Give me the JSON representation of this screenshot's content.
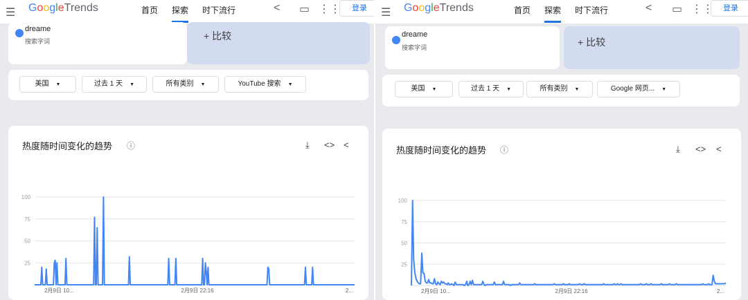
{
  "header": {
    "logo_google_letters": [
      "G",
      "o",
      "o",
      "g",
      "l",
      "e"
    ],
    "logo_trends": "Trends",
    "nav": [
      {
        "label": "首页"
      },
      {
        "label": "探索"
      },
      {
        "label": "时下流行"
      }
    ],
    "login_label": "登录",
    "icons": [
      "menu-icon",
      "share-icon",
      "feedback-icon",
      "apps-icon"
    ]
  },
  "accent_color": "#1a73e8",
  "series_color": "#4285f4",
  "left": {
    "term": "dreame",
    "term_sub": "搜索字词",
    "compare_label": "+ 比较",
    "filters": [
      "美国",
      "过去 1 天",
      "所有类别",
      "YouTube 搜索"
    ],
    "chart_title": "热度随时间变化的趋势",
    "chart_data": {
      "type": "line",
      "ylim": [
        0,
        100
      ],
      "yticks": [
        "100",
        "75",
        "50",
        "25"
      ],
      "xticks": [
        "2月9日 10...",
        "2月9日 22:16",
        "2..."
      ],
      "values": [
        0,
        0,
        0,
        0,
        0,
        0,
        0,
        0,
        20,
        0,
        0,
        0,
        0,
        18,
        0,
        0,
        0,
        0,
        0,
        0,
        0,
        0,
        25,
        28,
        0,
        25,
        0,
        0,
        0,
        0,
        0,
        0,
        0,
        0,
        0,
        30,
        0,
        0,
        0,
        0,
        0,
        0,
        0,
        0,
        0,
        0,
        0,
        0,
        0,
        0,
        0,
        0,
        0,
        0,
        0,
        0,
        0,
        0,
        0,
        0,
        0,
        0,
        0,
        0,
        0,
        0,
        0,
        77,
        0,
        0,
        65,
        0,
        0,
        0,
        0,
        0,
        0,
        100,
        0,
        0,
        0,
        0,
        0,
        0,
        0,
        0,
        0,
        0,
        0,
        0,
        0,
        0,
        0,
        0,
        0,
        0,
        0,
        0,
        0,
        0,
        0,
        0,
        0,
        0,
        0,
        0,
        32,
        0,
        0,
        0,
        0,
        0,
        0,
        0,
        0,
        0,
        0,
        0,
        0,
        0,
        0,
        0,
        0,
        0,
        0,
        0,
        0,
        0,
        0,
        0,
        0,
        0,
        0,
        0,
        0,
        0,
        0,
        0,
        0,
        0,
        0,
        0,
        0,
        0,
        0,
        0,
        0,
        0,
        0,
        0,
        30,
        0,
        0,
        0,
        0,
        0,
        0,
        0,
        30,
        0,
        0,
        0,
        0,
        0,
        0,
        0,
        0,
        0,
        0,
        0,
        0,
        0,
        0,
        0,
        0,
        0,
        0,
        0,
        0,
        0,
        0,
        0,
        0,
        0,
        0,
        0,
        0,
        0,
        30,
        0,
        0,
        25,
        15,
        0,
        20,
        0,
        0,
        0,
        0,
        0,
        0,
        0,
        0,
        0,
        0,
        0,
        0,
        0,
        0,
        0,
        0,
        0,
        0,
        0,
        0,
        0,
        0,
        0,
        0,
        0,
        0,
        0,
        0,
        0,
        0,
        0,
        0,
        0,
        0,
        0,
        0,
        0,
        0,
        0,
        0,
        0,
        0,
        0,
        0,
        0,
        0,
        0,
        0,
        0,
        0,
        0,
        0,
        0,
        0,
        0,
        0,
        0,
        0,
        0,
        0,
        0,
        0,
        0,
        0,
        0,
        0,
        20,
        18,
        0,
        0,
        0,
        0,
        0,
        0,
        0,
        0,
        0,
        0,
        0,
        0,
        0,
        0,
        0,
        0,
        0,
        0,
        0,
        0,
        0,
        0,
        0,
        0,
        0,
        0,
        0,
        0,
        0,
        0,
        0,
        0,
        0,
        0,
        0,
        0,
        0,
        0,
        0,
        0,
        20,
        0,
        0,
        0,
        0,
        0,
        0,
        0,
        20,
        0,
        0,
        0,
        0,
        0,
        0,
        0,
        0,
        0,
        0,
        0,
        0,
        0,
        0,
        0,
        0,
        0,
        0,
        0,
        0,
        0,
        0,
        0,
        0,
        0,
        0,
        0,
        0,
        0,
        0,
        0,
        0,
        0,
        0,
        0,
        0,
        0,
        0,
        0,
        0,
        0,
        0,
        0,
        0,
        0,
        0,
        0
      ]
    }
  },
  "right": {
    "term": "dreame",
    "term_sub": "搜索字词",
    "compare_label": "+ 比较",
    "filters": [
      "美国",
      "过去 1 天",
      "所有类别",
      "Google 网页..."
    ],
    "chart_title": "热度随时间变化的趋势",
    "chart_data": {
      "type": "line",
      "ylim": [
        0,
        100
      ],
      "yticks": [
        "100",
        "75",
        "50",
        "25"
      ],
      "xticks": [
        "2月9日 10...",
        "2月9日 22:16",
        "2..."
      ],
      "values": [
        0,
        100,
        30,
        15,
        8,
        5,
        3,
        2,
        2,
        38,
        15,
        14,
        5,
        3,
        3,
        7,
        3,
        3,
        2,
        2,
        8,
        2,
        1,
        4,
        2,
        1,
        5,
        3,
        4,
        2,
        2,
        1,
        3,
        1,
        1,
        2,
        1,
        0,
        4,
        1,
        1,
        1,
        1,
        1,
        1,
        1,
        0,
        1,
        5,
        0,
        1,
        5,
        1,
        6,
        1,
        1,
        1,
        1,
        1,
        1,
        1,
        1,
        5,
        1,
        0,
        1,
        1,
        1,
        1,
        1,
        1,
        1,
        4,
        1,
        1,
        1,
        1,
        1,
        1,
        1,
        5,
        1,
        1,
        1,
        1,
        1,
        0,
        1,
        1,
        1,
        1,
        1,
        1,
        1,
        3,
        1,
        1,
        1,
        1,
        1,
        1,
        1,
        1,
        1,
        1,
        1,
        1,
        2,
        1,
        1,
        1,
        1,
        1,
        1,
        1,
        1,
        1,
        1,
        1,
        1,
        1,
        1,
        1,
        1,
        2,
        1,
        1,
        1,
        1,
        1,
        1,
        1,
        2,
        1,
        1,
        1,
        1,
        2,
        1,
        1,
        1,
        1,
        1,
        1,
        1,
        1,
        2,
        1,
        1,
        1,
        2,
        1,
        1,
        1,
        1,
        1,
        1,
        1,
        1,
        1,
        1,
        1,
        1,
        1,
        1,
        1,
        1,
        2,
        1,
        1,
        1,
        1,
        1,
        1,
        1,
        1,
        2,
        1,
        1,
        2,
        1,
        1,
        2,
        1,
        1,
        1,
        1,
        1,
        1,
        1,
        1,
        1,
        1,
        1,
        1,
        1,
        1,
        1,
        1,
        2,
        1,
        1,
        1,
        1,
        2,
        1,
        1,
        1,
        2,
        1,
        1,
        1,
        1,
        1,
        1,
        1,
        1,
        2,
        1,
        1,
        1,
        1,
        1,
        1,
        2,
        1,
        1,
        1,
        1,
        1,
        2,
        1,
        1,
        1,
        1,
        1,
        1,
        1,
        1,
        1,
        1,
        1,
        1,
        1,
        1,
        1,
        1,
        1,
        1,
        1,
        1,
        1,
        1,
        2,
        1,
        1,
        1,
        1,
        2,
        1,
        1,
        1,
        12,
        5,
        2,
        2,
        2,
        2,
        2,
        2,
        2,
        2,
        2,
        3
      ]
    }
  }
}
